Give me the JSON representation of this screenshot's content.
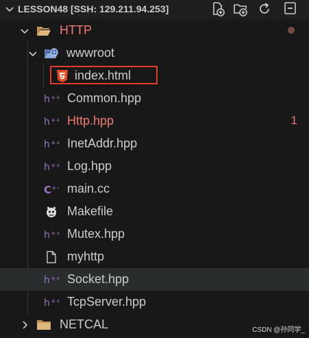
{
  "header": {
    "title": "LESSON48 [SSH: 129.211.94.253]",
    "actions": [
      "new-file-icon",
      "new-folder-icon",
      "refresh-icon",
      "collapse-all-icon"
    ]
  },
  "tree": {
    "http_folder": {
      "label": "HTTP",
      "expanded": true,
      "status": "modified"
    },
    "wwwroot_folder": {
      "label": "wwwroot",
      "expanded": true
    },
    "files": [
      {
        "label": "index.html",
        "icon": "html5-icon",
        "highlighted": true
      },
      {
        "label": "Common.hpp",
        "icon": "cpp-header-icon"
      },
      {
        "label": "Http.hpp",
        "icon": "cpp-header-icon",
        "problems": "1"
      },
      {
        "label": "InetAddr.hpp",
        "icon": "cpp-header-icon"
      },
      {
        "label": "Log.hpp",
        "icon": "cpp-header-icon"
      },
      {
        "label": "main.cc",
        "icon": "cpp-source-icon"
      },
      {
        "label": "Makefile",
        "icon": "makefile-icon"
      },
      {
        "label": "Mutex.hpp",
        "icon": "cpp-header-icon"
      },
      {
        "label": "myhttp",
        "icon": "file-icon"
      },
      {
        "label": "Socket.hpp",
        "icon": "cpp-header-icon",
        "hovered": true
      },
      {
        "label": "TcpServer.hpp",
        "icon": "cpp-header-icon"
      }
    ],
    "netcal_folder": {
      "label": "NETCAL",
      "expanded": false
    }
  },
  "colors": {
    "background": "#181818",
    "error_text": "#f17b70",
    "highlight_box": "#e23c32",
    "header_icon_purple": "#a074c4",
    "folder": "#c09553"
  },
  "watermark": "CSDN @孙同学_"
}
